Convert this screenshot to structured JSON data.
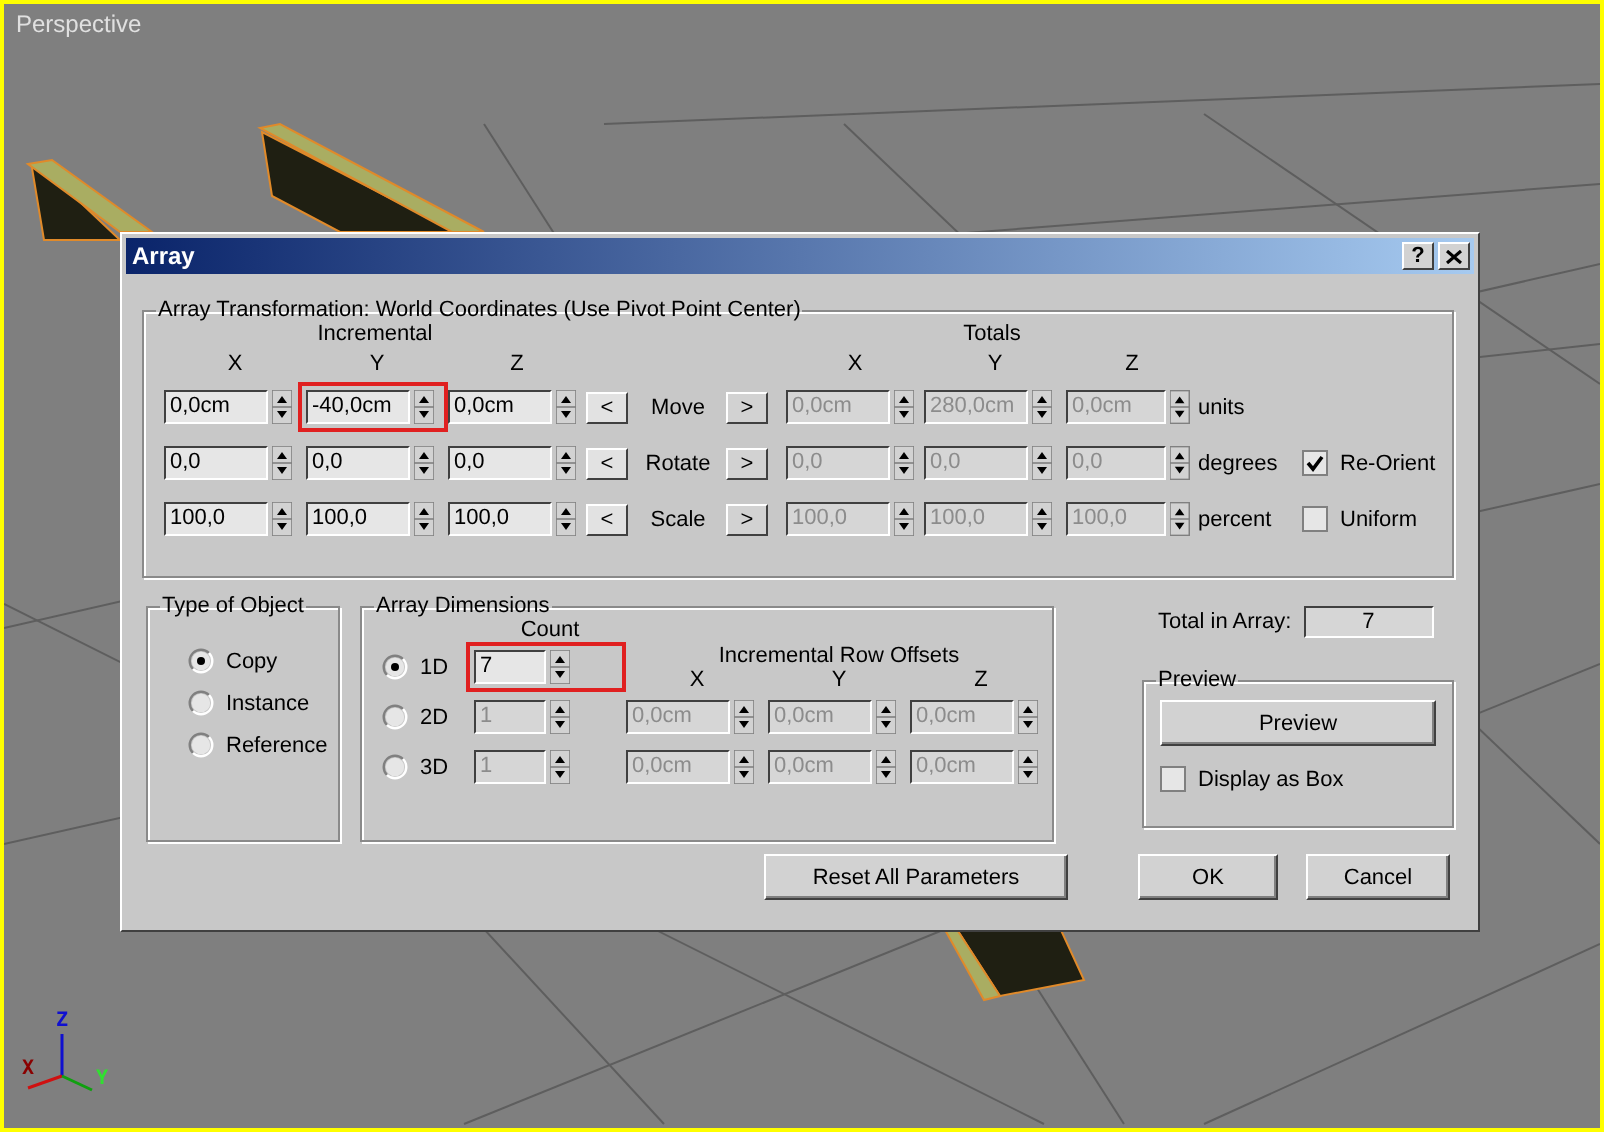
{
  "viewport": {
    "label": "Perspective",
    "axis_labels": [
      "X",
      "Y",
      "Z"
    ]
  },
  "dialog": {
    "title": "Array",
    "help_button": "?",
    "transformation": {
      "title": "Array Transformation: World Coordinates (Use Pivot Point Center)",
      "incremental_label": "Incremental",
      "totals_label": "Totals",
      "incremental_axes": [
        "X",
        "Y",
        "Z"
      ],
      "totals_axes": [
        "X",
        "Y",
        "Z"
      ],
      "rows": [
        {
          "label": "Move",
          "left_button": "<",
          "right_button": ">",
          "unit": "units",
          "incremental": [
            {
              "value": "0,0cm",
              "disabled": false,
              "highlighted": false
            },
            {
              "value": "-40,0cm",
              "disabled": false,
              "highlighted": true
            },
            {
              "value": "0,0cm",
              "disabled": false,
              "highlighted": false
            }
          ],
          "totals": [
            {
              "value": "0,0cm",
              "disabled": true,
              "highlighted": false
            },
            {
              "value": "280,0cm",
              "disabled": true,
              "highlighted": false
            },
            {
              "value": "0,0cm",
              "disabled": true,
              "highlighted": false
            }
          ]
        },
        {
          "label": "Rotate",
          "left_button": "<",
          "right_button": ">",
          "unit": "degrees",
          "incremental": [
            {
              "value": "0,0",
              "disabled": false,
              "highlighted": false
            },
            {
              "value": "0,0",
              "disabled": false,
              "highlighted": false
            },
            {
              "value": "0,0",
              "disabled": false,
              "highlighted": false
            }
          ],
          "totals": [
            {
              "value": "0,0",
              "disabled": true,
              "highlighted": false
            },
            {
              "value": "0,0",
              "disabled": true,
              "highlighted": false
            },
            {
              "value": "0,0",
              "disabled": true,
              "highlighted": false
            }
          ],
          "option": {
            "label": "Re-Orient",
            "checked": true
          }
        },
        {
          "label": "Scale",
          "left_button": "<",
          "right_button": ">",
          "unit": "percent",
          "incremental": [
            {
              "value": "100,0",
              "disabled": false,
              "highlighted": false
            },
            {
              "value": "100,0",
              "disabled": false,
              "highlighted": false
            },
            {
              "value": "100,0",
              "disabled": false,
              "highlighted": false
            }
          ],
          "totals": [
            {
              "value": "100,0",
              "disabled": true,
              "highlighted": false
            },
            {
              "value": "100,0",
              "disabled": true,
              "highlighted": false
            },
            {
              "value": "100,0",
              "disabled": true,
              "highlighted": false
            }
          ],
          "option": {
            "label": "Uniform",
            "checked": false
          }
        }
      ]
    },
    "type_of_object": {
      "title": "Type of Object",
      "options": [
        {
          "label": "Copy",
          "selected": true
        },
        {
          "label": "Instance",
          "selected": false
        },
        {
          "label": "Reference",
          "selected": false
        }
      ]
    },
    "array_dimensions": {
      "title": "Array Dimensions",
      "count_label": "Count",
      "offsets_label": "Incremental Row Offsets",
      "offset_axes": [
        "X",
        "Y",
        "Z"
      ],
      "rows": [
        {
          "label": "1D",
          "selected": true,
          "count": {
            "value": "7",
            "disabled": false,
            "highlighted": true
          }
        },
        {
          "label": "2D",
          "selected": false,
          "count": {
            "value": "1",
            "disabled": true,
            "highlighted": false
          },
          "offsets": [
            {
              "value": "0,0cm",
              "disabled": true,
              "highlighted": false
            },
            {
              "value": "0,0cm",
              "disabled": true,
              "highlighted": false
            },
            {
              "value": "0,0cm",
              "disabled": true,
              "highlighted": false
            }
          ]
        },
        {
          "label": "3D",
          "selected": false,
          "count": {
            "value": "1",
            "disabled": true,
            "highlighted": false
          },
          "offsets": [
            {
              "value": "0,0cm",
              "disabled": true,
              "highlighted": false
            },
            {
              "value": "0,0cm",
              "disabled": true,
              "highlighted": false
            },
            {
              "value": "0,0cm",
              "disabled": true,
              "highlighted": false
            }
          ]
        }
      ]
    },
    "total_in_array": {
      "label": "Total in Array:",
      "value": "7"
    },
    "preview": {
      "title": "Preview",
      "button": "Preview",
      "display_as_box": {
        "label": "Display as Box",
        "checked": false
      }
    },
    "buttons": [
      "Reset All Parameters",
      "OK",
      "Cancel"
    ]
  }
}
